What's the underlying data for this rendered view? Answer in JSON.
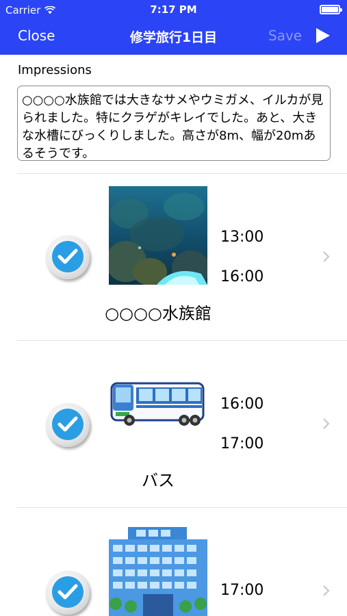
{
  "status_bar": {
    "carrier": "Carrier",
    "time": "7:17 PM"
  },
  "nav": {
    "close_label": "Close",
    "title": "修学旅行1日目",
    "save_label": "Save",
    "play_icon": "play-icon"
  },
  "impressions": {
    "label": "Impressions",
    "text": "○○○○水族館では大きなサメやウミガメ、イルカが見られました。特にクラゲがキレイでした。あと、大きな水槽にびっくりしました。高さが8m、幅が20mあるそうです。"
  },
  "itinerary": [
    {
      "name": "○○○○水族館",
      "start": "13:00",
      "end": "16:00",
      "checked": true,
      "image": "aquarium-photo"
    },
    {
      "name": "バス",
      "start": "16:00",
      "end": "17:00",
      "checked": true,
      "image": "bus-illustration"
    },
    {
      "name": "",
      "start": "17:00",
      "end": "",
      "checked": true,
      "image": "building-illustration"
    }
  ],
  "colors": {
    "nav_bar": "#2b44f5",
    "check": "#2a9ee4",
    "save_disabled": "#8a96f7"
  }
}
